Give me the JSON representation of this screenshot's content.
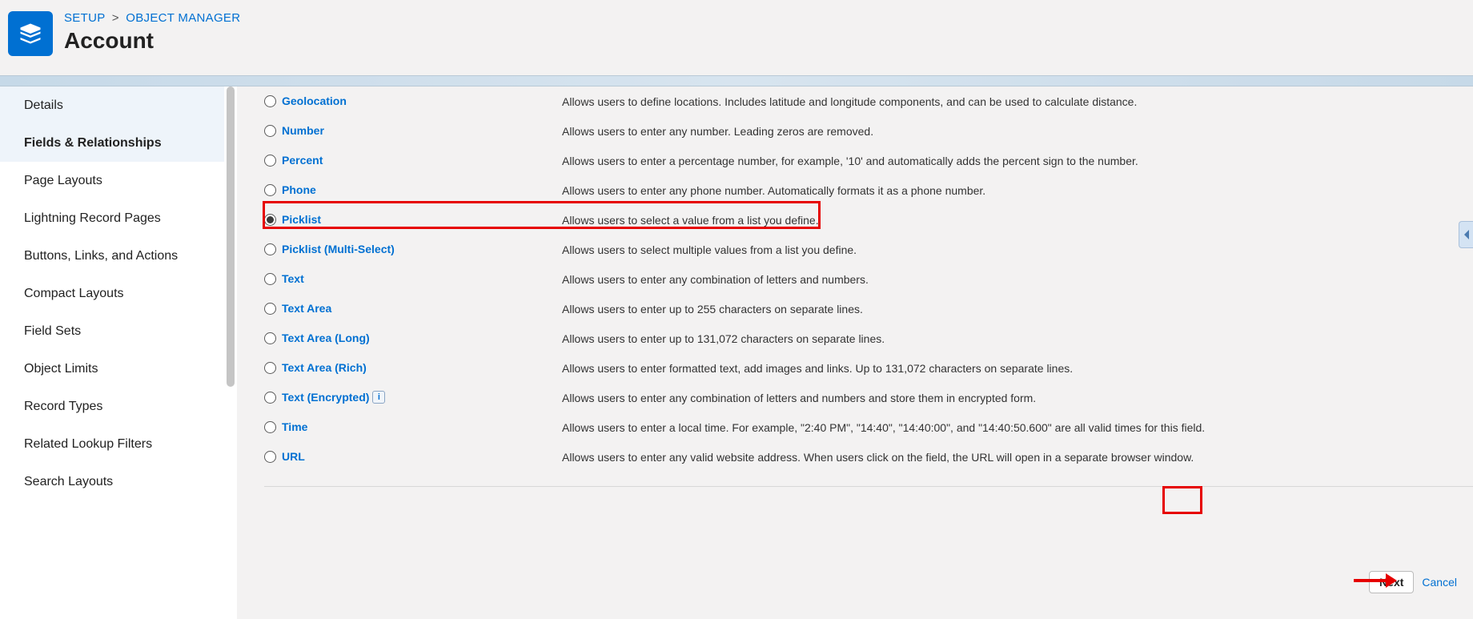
{
  "breadcrumb": {
    "setup": "SETUP",
    "object_manager": "OBJECT MANAGER",
    "sep": ">"
  },
  "page_title": "Account",
  "sidebar": {
    "items": [
      {
        "label": "Details"
      },
      {
        "label": "Fields & Relationships"
      },
      {
        "label": "Page Layouts"
      },
      {
        "label": "Lightning Record Pages"
      },
      {
        "label": "Buttons, Links, and Actions"
      },
      {
        "label": "Compact Layouts"
      },
      {
        "label": "Field Sets"
      },
      {
        "label": "Object Limits"
      },
      {
        "label": "Record Types"
      },
      {
        "label": "Related Lookup Filters"
      },
      {
        "label": "Search Layouts"
      }
    ]
  },
  "field_types": [
    {
      "label": "Geolocation",
      "desc": "Allows users to define locations. Includes latitude and longitude components, and can be used to calculate distance.",
      "selected": false
    },
    {
      "label": "Number",
      "desc": "Allows users to enter any number. Leading zeros are removed.",
      "selected": false
    },
    {
      "label": "Percent",
      "desc": "Allows users to enter a percentage number, for example, '10' and automatically adds the percent sign to the number.",
      "selected": false
    },
    {
      "label": "Phone",
      "desc": "Allows users to enter any phone number. Automatically formats it as a phone number.",
      "selected": false
    },
    {
      "label": "Picklist",
      "desc": "Allows users to select a value from a list you define.",
      "selected": true
    },
    {
      "label": "Picklist (Multi-Select)",
      "desc": "Allows users to select multiple values from a list you define.",
      "selected": false
    },
    {
      "label": "Text",
      "desc": "Allows users to enter any combination of letters and numbers.",
      "selected": false
    },
    {
      "label": "Text Area",
      "desc": "Allows users to enter up to 255 characters on separate lines.",
      "selected": false
    },
    {
      "label": "Text Area (Long)",
      "desc": "Allows users to enter up to 131,072 characters on separate lines.",
      "selected": false
    },
    {
      "label": "Text Area (Rich)",
      "desc": "Allows users to enter formatted text, add images and links. Up to 131,072 characters on separate lines.",
      "selected": false
    },
    {
      "label": "Text (Encrypted)",
      "desc": "Allows users to enter any combination of letters and numbers and store them in encrypted form.",
      "selected": false,
      "info": true
    },
    {
      "label": "Time",
      "desc": "Allows users to enter a local time. For example, \"2:40 PM\", \"14:40\", \"14:40:00\", and \"14:40:50.600\" are all valid times for this field.",
      "selected": false
    },
    {
      "label": "URL",
      "desc": "Allows users to enter any valid website address. When users click on the field, the URL will open in a separate browser window.",
      "selected": false
    }
  ],
  "footer": {
    "next": "Next",
    "cancel": "Cancel"
  },
  "info_char": "i"
}
